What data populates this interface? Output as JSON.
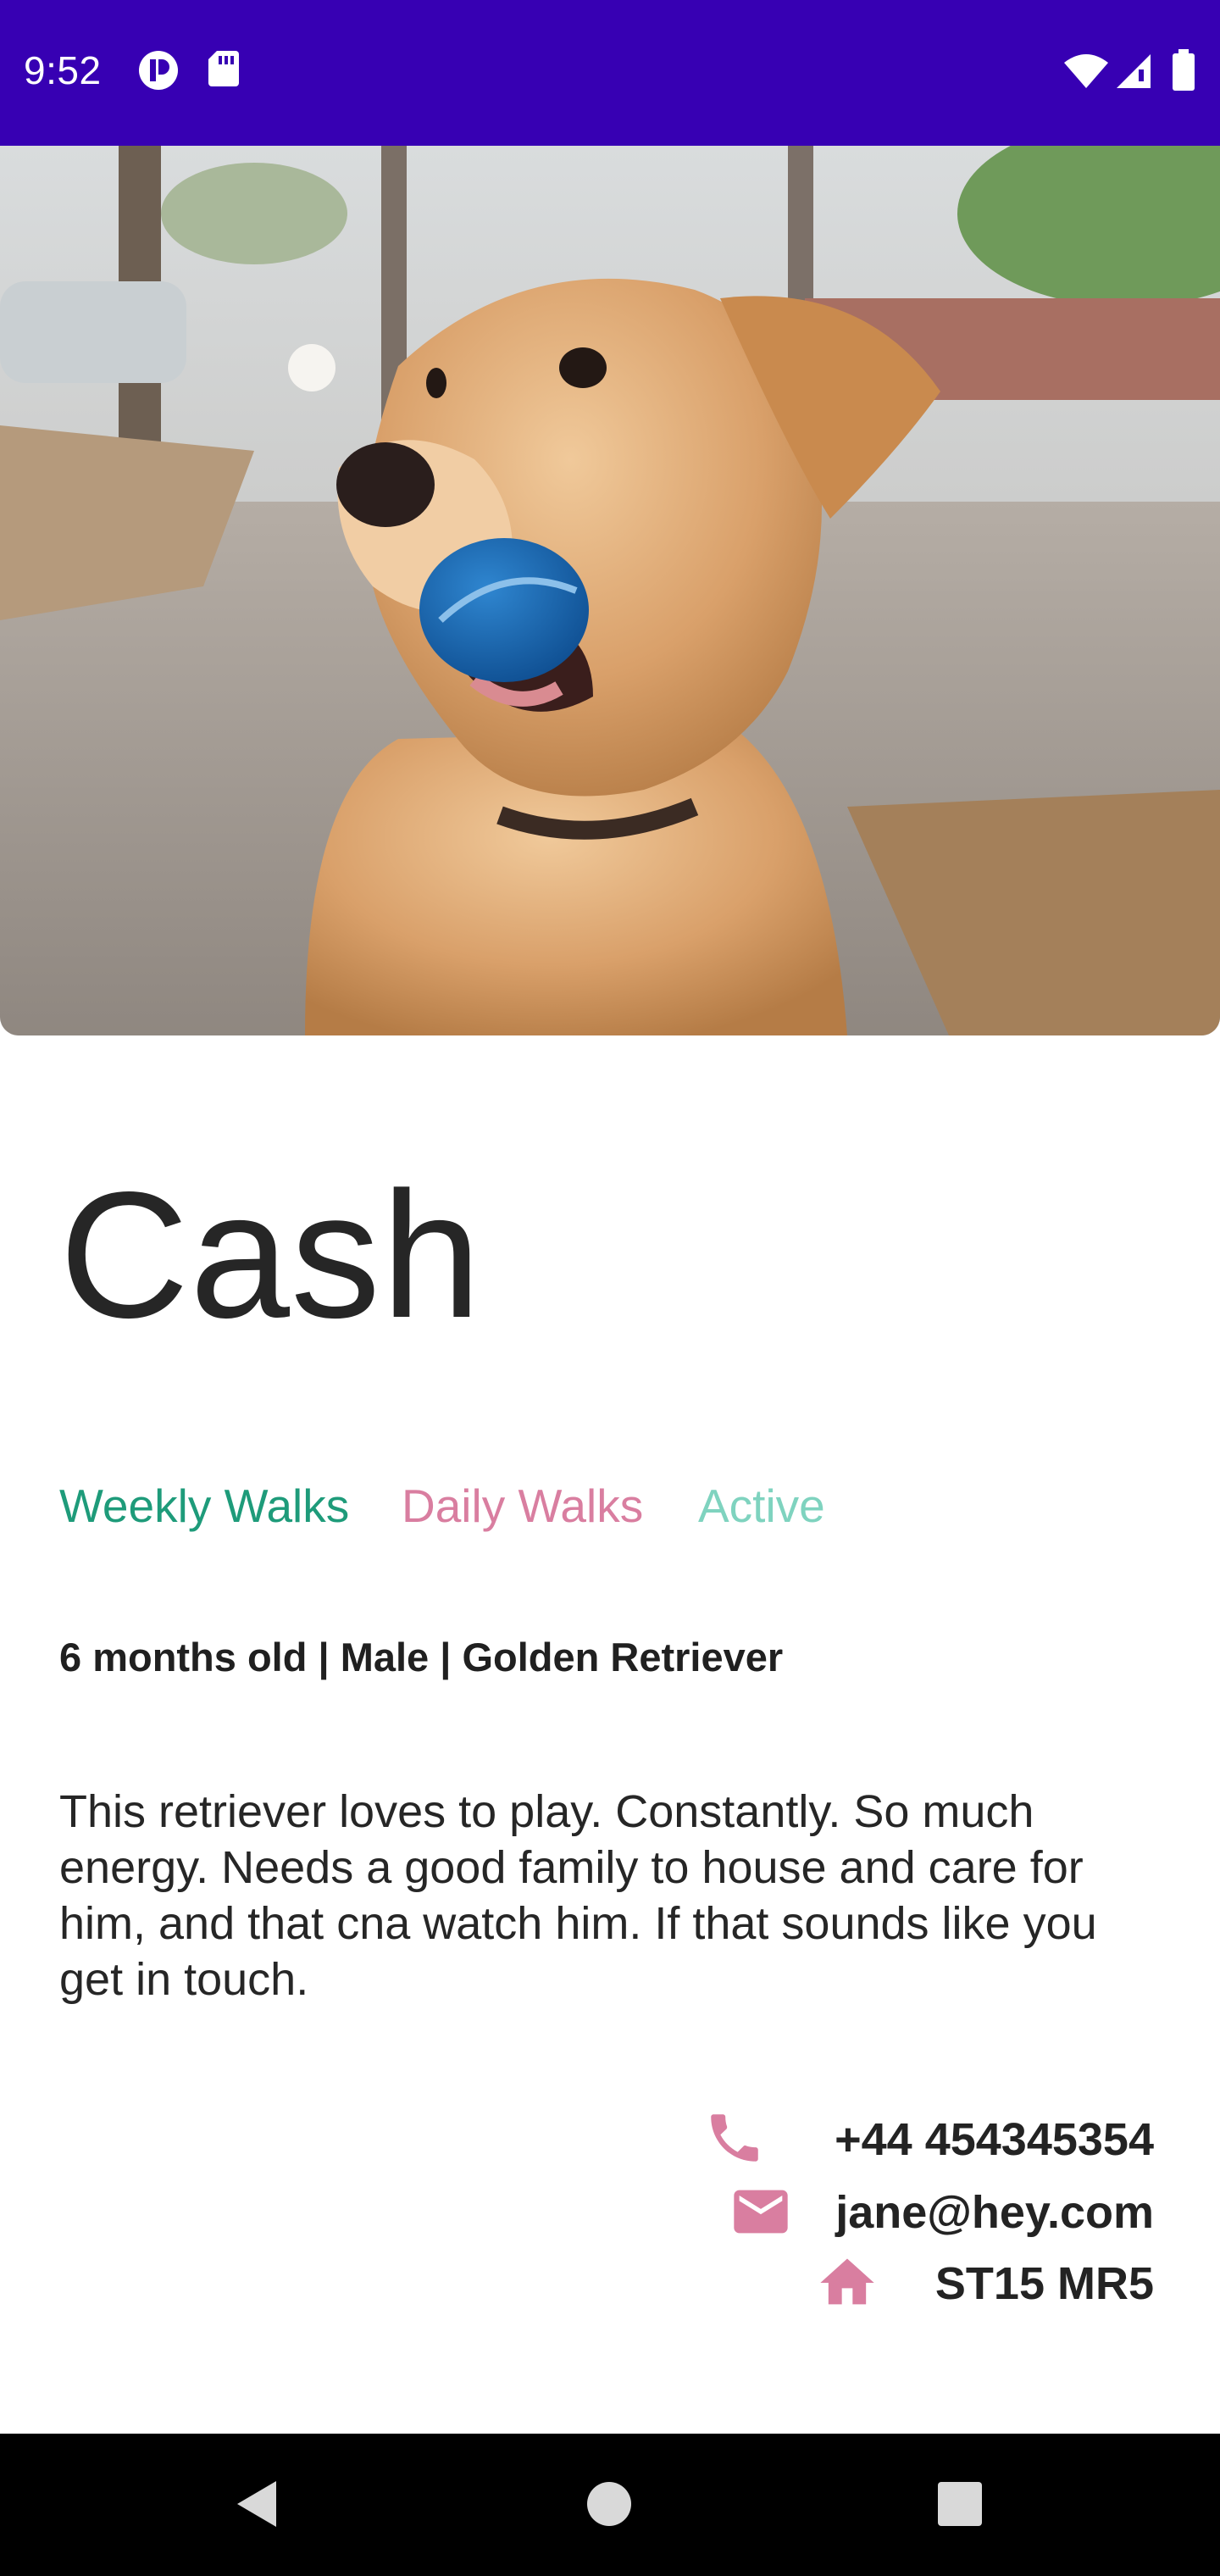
{
  "status_bar": {
    "time": "9:52",
    "left_icons": [
      "app-notification-icon",
      "sd-card-icon"
    ],
    "right_icons": [
      "wifi-icon",
      "signal-icon",
      "battery-icon"
    ],
    "background": "#3700b3"
  },
  "hero": {
    "image_description_icon": "dog-photo",
    "alt": "Golden retriever holding a blue ball"
  },
  "pet": {
    "name": "Cash",
    "tags": [
      {
        "label": "Weekly Walks",
        "color": "#1e9b7a"
      },
      {
        "label": "Daily Walks",
        "color": "#d97ea0"
      },
      {
        "label": "Active",
        "color": "#7fd3bf"
      }
    ],
    "details": "6 months old | Male | Golden Retriever",
    "description": "This retriever loves to play. Constantly. So much energy. Needs a good family to house and care for him, and that cna watch him. If that sounds like you get in touch."
  },
  "contact": {
    "phone": "+44 454345354",
    "email": "jane@hey.com",
    "postcode": "ST15 MR5",
    "icon_color": "#d97ea0"
  },
  "nav_bar": {
    "buttons": [
      "back-icon",
      "home-icon",
      "recents-icon"
    ]
  }
}
